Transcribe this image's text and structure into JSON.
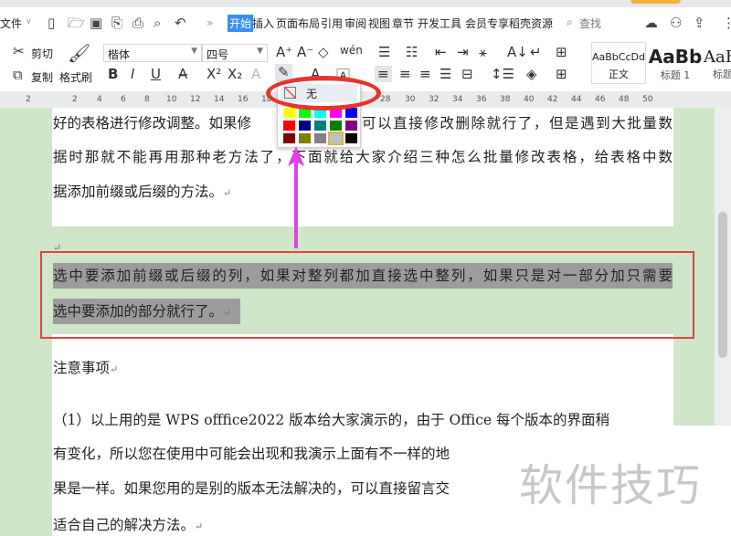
{
  "menubar": {
    "file": "文件",
    "tabs": [
      "开始",
      "插入",
      "页面布局",
      "引用",
      "审阅",
      "视图",
      "章节",
      "开发工具",
      "会员专享",
      "稻壳资源"
    ],
    "search": "查找"
  },
  "ribbon": {
    "cut": "剪切",
    "copy": "复制",
    "format_painter": "格式刷",
    "font": "楷体",
    "size": "四号",
    "styles": [
      {
        "preview": "AaBbCcDd",
        "label": "正文"
      },
      {
        "preview": "AaBb",
        "label": "标题 1"
      },
      {
        "preview": "AaB",
        "label": "标题"
      }
    ]
  },
  "ruler": [
    "2",
    "2",
    "4",
    "6",
    "8",
    "10",
    "12",
    "14",
    "16",
    "18",
    "28",
    "30",
    "32",
    "34",
    "36",
    "38",
    "40",
    "42",
    "44",
    "46",
    "48",
    "50"
  ],
  "highlight_popup": {
    "none_label": "无",
    "colors": [
      "#ffff00",
      "#00ff00",
      "#00ffff",
      "#ff00ff",
      "#0000ff",
      "#ff0000",
      "#000080",
      "#008080",
      "#008000",
      "#800080",
      "#800000",
      "#808000",
      "#808080",
      "#c0c0c0",
      "#000000"
    ],
    "selected_color": "#c0c0c0"
  },
  "document": {
    "p1_l1_a": "好的表格进行修改调整。如果修",
    "p1_l1_b": "可以直接修改删除就行了，但是遇到大批量数",
    "p1_l2": "据时那就不能再用那种老方法了，下面就给大家介绍三种怎么批量修改表格，给表格中数",
    "p1_l3": "据添加前缀或后缀的方法。",
    "p2_l1": "选中要添加前缀或后缀的列，如果对整列都加直接选中整列，如果只是对一部分加只需要",
    "p2_l2": "选中要添加的部分就行了。",
    "notes_title": "注意事项",
    "n1": "（1）以上用的是 WPS offfice2022 版本给大家演示的，由于 Office 每个版本的界面稍",
    "n2": "有变化，所以您在使用中可能会出现和我演示上面有不一样的地",
    "n3": "果是一样。如果您用的是别的版本无法解决的，可以直接留言交",
    "n4": "适合自己的解决方法。",
    "para_mark": "↵"
  },
  "watermark": "软件技巧",
  "colors": {
    "accent": "#3c8ff0",
    "annotation_red": "#e0443a",
    "arrow": "#e040e8",
    "page_bg": "#cfe6c8"
  }
}
